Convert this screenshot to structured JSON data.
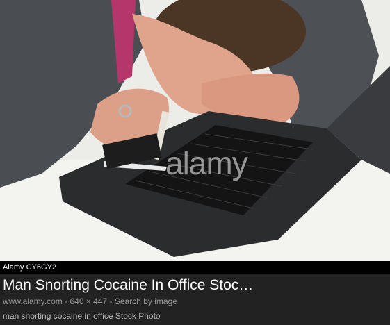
{
  "image": {
    "watermark": "alamy"
  },
  "source_bar": {
    "text": "Alamy  CY6GY2"
  },
  "result": {
    "title": "Man Snorting Cocaine In Office Stoc…",
    "domain": "www.alamy.com",
    "separator1": " - ",
    "dimensions": "640 × 447",
    "separator2": " - ",
    "search_by_image": "Search by image",
    "description": "man snorting cocaine in office Stock Photo"
  },
  "colors": {
    "background": "#222222",
    "source_bar": "#000000",
    "title": "#ffffff",
    "meta": "#9a9a9a"
  }
}
